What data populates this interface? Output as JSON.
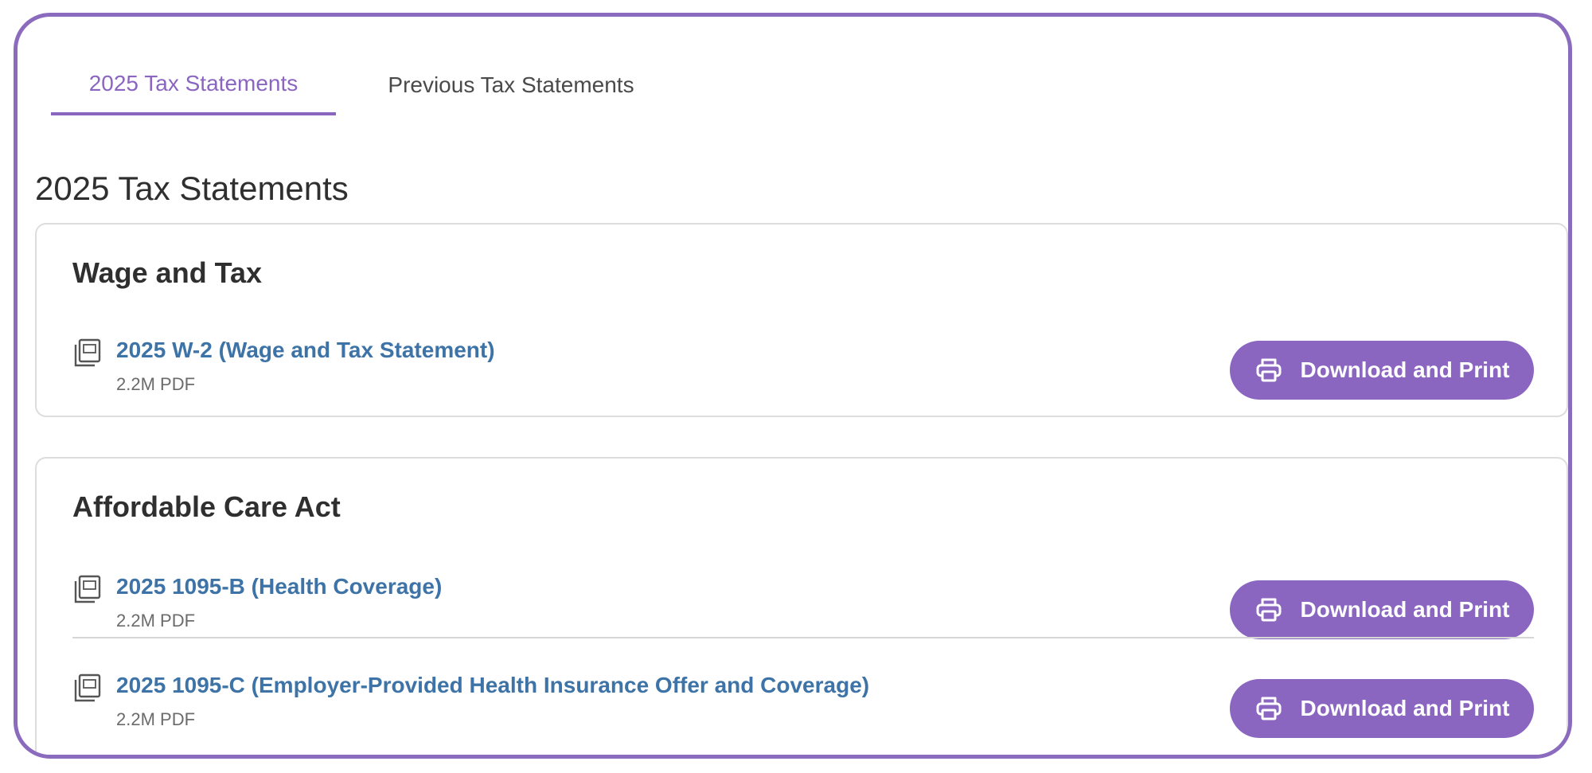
{
  "tabs": [
    {
      "label": "2025 Tax Statements",
      "active": true
    },
    {
      "label": "Previous Tax Statements",
      "active": false
    }
  ],
  "page_title": "2025 Tax Statements",
  "sections": [
    {
      "title": "Wage and Tax",
      "documents": [
        {
          "title": "2025 W-2 (Wage and Tax Statement)",
          "meta": "2.2M PDF",
          "action": "Download and Print",
          "icon": "pdf-document-icon"
        }
      ]
    },
    {
      "title": "Affordable Care Act",
      "documents": [
        {
          "title": "2025 1095-B (Health Coverage)",
          "meta": "2.2M PDF",
          "action": "Download and Print",
          "icon": "pdf-document-icon"
        },
        {
          "title": "2025 1095-C (Employer-Provided Health Insurance Offer and Coverage)",
          "meta": "2.2M PDF",
          "action": "Download and Print",
          "icon": "pdf-document-icon"
        }
      ]
    }
  ],
  "colors": {
    "accent": "#8b66c1",
    "link": "#3d73a6",
    "frame": "#8a6bbd",
    "border": "#dddddd",
    "text": "#2f2f2f",
    "muted": "#6b6b6b"
  },
  "icons": {
    "document": "pdf-document-icon",
    "print": "printer-icon"
  }
}
